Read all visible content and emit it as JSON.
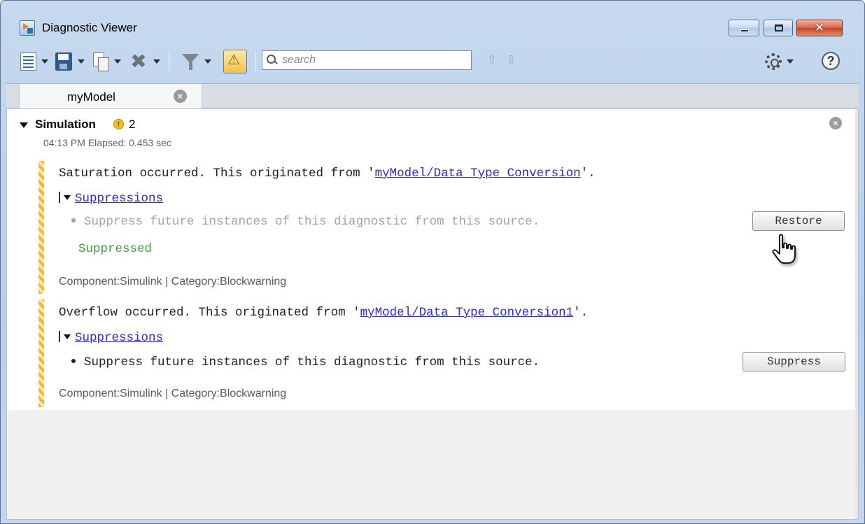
{
  "window": {
    "title": "Diagnostic Viewer",
    "close_glyph": "✕",
    "colors": {
      "link": "#2b2bd6",
      "suppressed": "#3f9b3f",
      "warning": "#f1b72e"
    }
  },
  "toolbar": {
    "search_placeholder": "search",
    "prev_arrow": "⇧",
    "next_arrow": "⇩",
    "clear_glyph": "✖",
    "help_glyph": "?"
  },
  "tabs": [
    {
      "label": "myModel",
      "close_glyph": "×"
    }
  ],
  "section": {
    "title": "Simulation",
    "warning_glyph": "!",
    "warning_count": "2",
    "meta": "04:13 PM   Elapsed: 0.453 sec",
    "close_glyph": "×"
  },
  "messages": [
    {
      "text_before": "Saturation occurred. This originated from '",
      "link": "myModel/Data Type Conversion",
      "text_after": "'.",
      "suppressions_label": "Suppressions",
      "suppression_item": "Suppress future instances of this diagnostic from this source.",
      "button_label": "Restore",
      "status": "Suppressed",
      "meta": "Component:Simulink | Category:Blockwarning"
    },
    {
      "text_before": "Overflow occurred. This originated from '",
      "link": "myModel/Data Type Conversion1",
      "text_after": "'.",
      "suppressions_label": "Suppressions",
      "suppression_item": "Suppress future instances of this diagnostic from this source.",
      "button_label": "Suppress",
      "meta": "Component:Simulink | Category:Blockwarning"
    }
  ]
}
